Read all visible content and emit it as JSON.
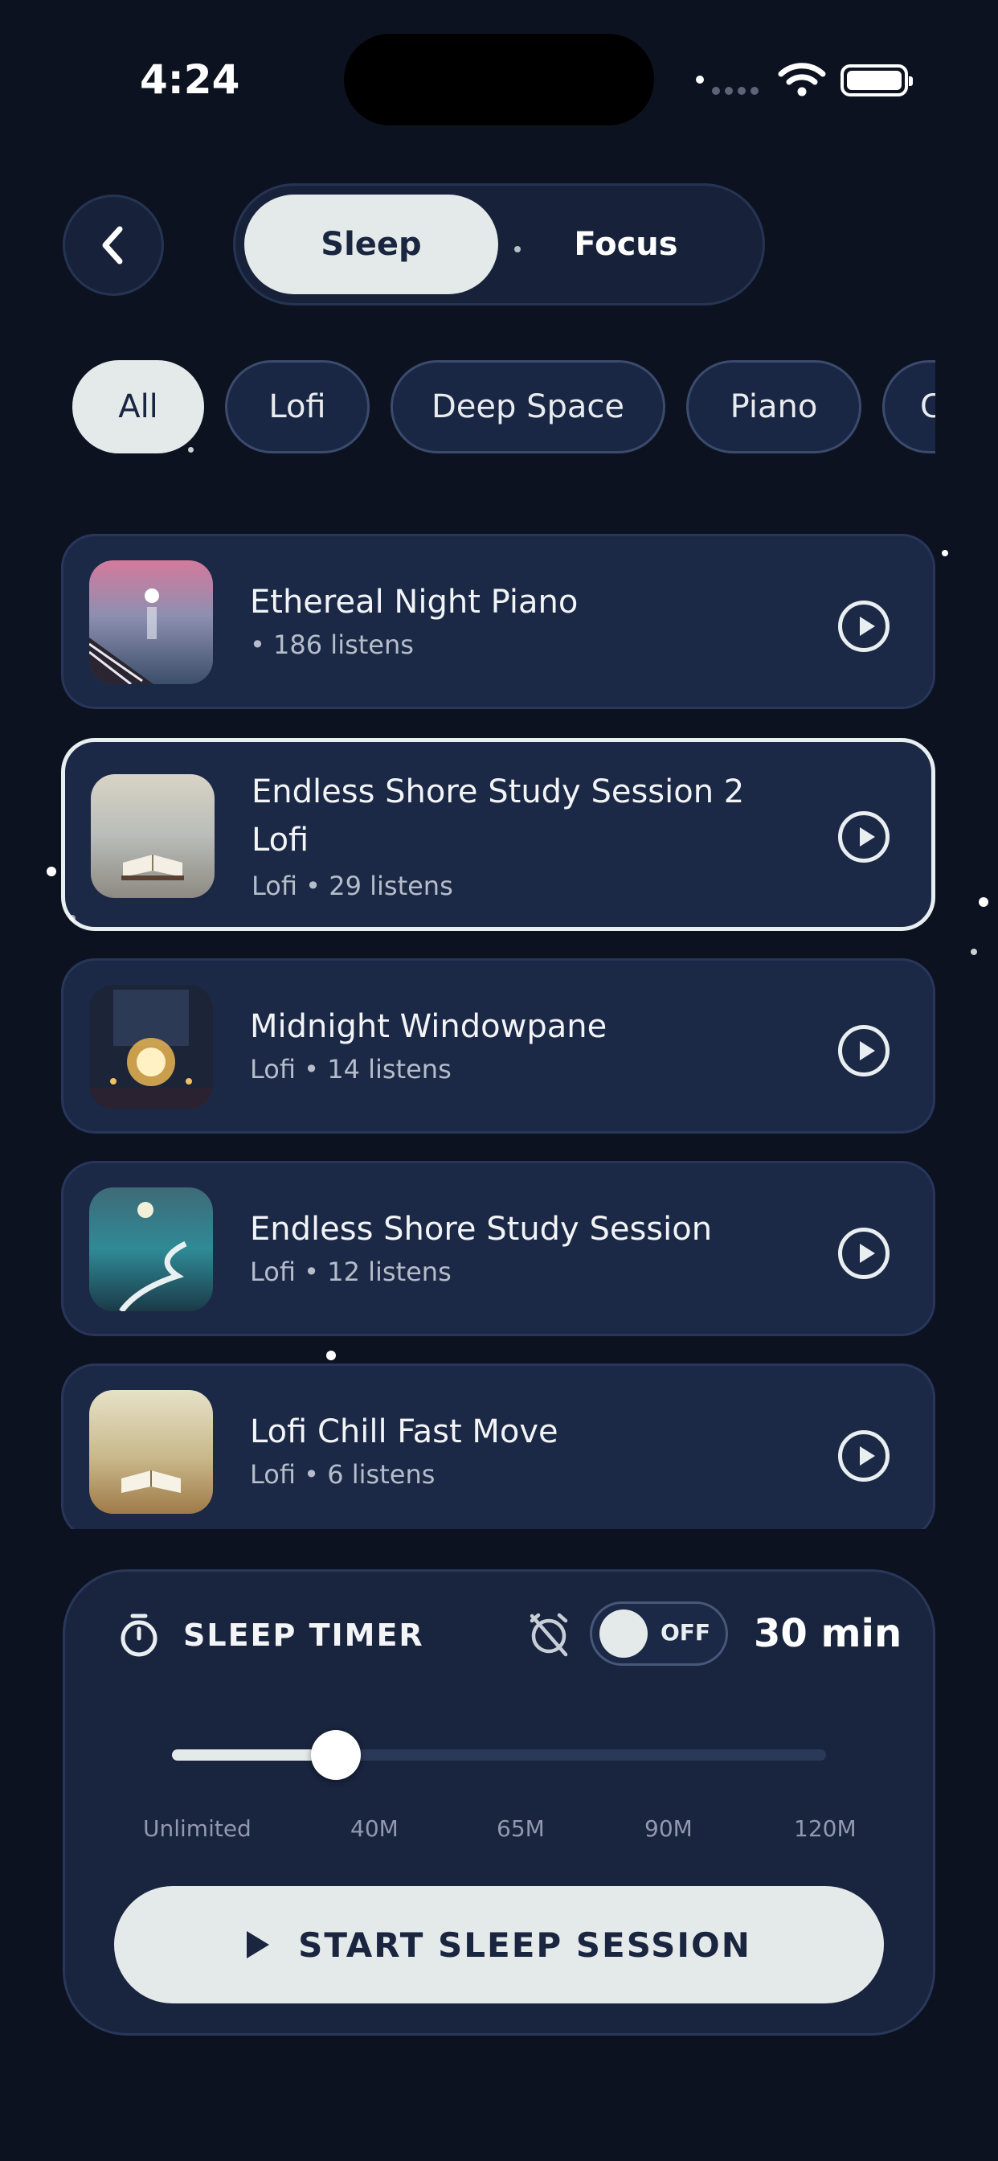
{
  "status_bar": {
    "time": "4:24"
  },
  "header": {
    "back_icon": "chevron-left-icon",
    "segments": [
      {
        "label": "Sleep",
        "selected": true
      },
      {
        "label": "Focus",
        "selected": false
      }
    ]
  },
  "filters": {
    "chips": [
      {
        "label": "All",
        "active": true
      },
      {
        "label": "Lofi",
        "active": false
      },
      {
        "label": "Deep Space",
        "active": false
      },
      {
        "label": "Piano",
        "active": false
      },
      {
        "label": "C",
        "active": false
      }
    ]
  },
  "tracks": [
    {
      "title": "Ethereal Night Piano",
      "meta": " • 186 listens",
      "selected": false
    },
    {
      "title": "Endless Shore Study Session 2\nLofi",
      "meta": "Lofi • 29 listens",
      "selected": true
    },
    {
      "title": "Midnight Windowpane",
      "meta": "Lofi • 14 listens",
      "selected": false
    },
    {
      "title": "Endless Shore Study Session",
      "meta": "Lofi • 12 listens",
      "selected": false
    },
    {
      "title": "Lofi Chill Fast Move",
      "meta": "Lofi • 6 listens",
      "selected": false
    }
  ],
  "sleep_timer": {
    "label": "SLEEP TIMER",
    "toggle_state": "OFF",
    "value": "30 min",
    "slider_ticks": [
      "Unlimited",
      "40M",
      "65M",
      "90M",
      "120M"
    ],
    "slider_fraction": 0.25,
    "start_label": "START SLEEP SESSION"
  },
  "colors": {
    "background": "#0c1220",
    "card": "#1c2946",
    "accent_light": "#e4e9ea",
    "text_dark": "#1a2540"
  }
}
